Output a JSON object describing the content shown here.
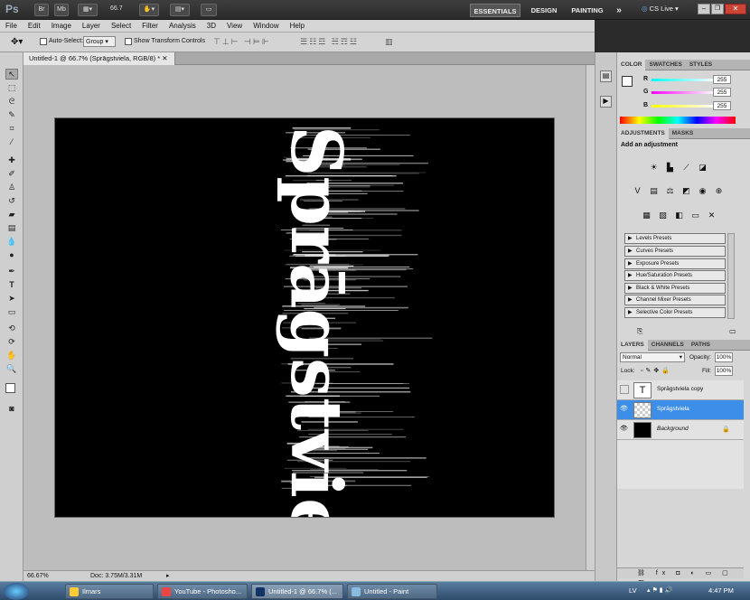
{
  "appbar": {
    "ps_logo": "Ps",
    "bridge": "Br",
    "minibridge": "Mb",
    "zoom": "66.7",
    "workspaces": [
      "ESSENTIALS",
      "DESIGN",
      "PAINTING"
    ],
    "more": "»",
    "cslive": "CS Live"
  },
  "menu": [
    "File",
    "Edit",
    "Image",
    "Layer",
    "Select",
    "Filter",
    "Analysis",
    "3D",
    "View",
    "Window",
    "Help"
  ],
  "options": {
    "auto_select_label": "Auto-Select:",
    "auto_select_value": "Group",
    "show_transform": "Show Transform Controls"
  },
  "document": {
    "tab_title": "Untitled-1 @ 66.7% (Sprāgstviela, RGB/8) *",
    "canvas_text": "Sprāgstviela"
  },
  "status": {
    "zoom": "66.67%",
    "doc": "Doc: 3.75M/3.31M"
  },
  "color_panel": {
    "tabs": [
      "COLOR",
      "SWATCHES",
      "STYLES"
    ],
    "r_label": "R",
    "g_label": "G",
    "b_label": "B",
    "r": "255",
    "g": "255",
    "b": "255"
  },
  "adjust_panel": {
    "tabs": [
      "ADJUSTMENTS",
      "MASKS"
    ],
    "heading": "Add an adjustment",
    "presets": [
      "Levels Presets",
      "Curves Presets",
      "Exposure Presets",
      "Hue/Saturation Presets",
      "Black & White Presets",
      "Channel Mixer Presets",
      "Selective Color Presets"
    ]
  },
  "layers_panel": {
    "tabs": [
      "LAYERS",
      "CHANNELS",
      "PATHS"
    ],
    "blend": "Normal",
    "opacity_label": "Opacity:",
    "opacity": "100%",
    "lock_label": "Lock:",
    "fill_label": "Fill:",
    "fill": "100%",
    "layers": [
      {
        "name": "Sprāgstviela copy",
        "thumb": "T"
      },
      {
        "name": "Sprāgstviela",
        "selected": true
      },
      {
        "name": "Background"
      }
    ]
  },
  "taskbar": {
    "items": [
      "Ilmars",
      "YouTube - Photosho...",
      "Untitled-1 @ 66.7% (...",
      "Untitled - Paint"
    ],
    "lang": "LV",
    "time": "4:47 PM"
  }
}
